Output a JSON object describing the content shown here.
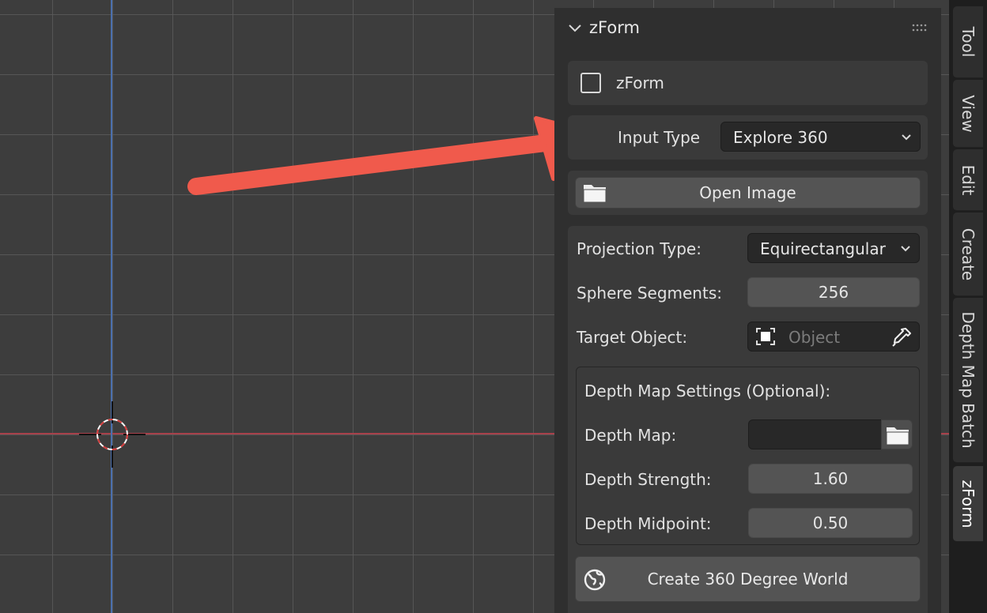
{
  "panel": {
    "title": "zForm",
    "enable_label": "zForm",
    "input_type_label": "Input Type",
    "input_type_value": "Explore 360",
    "open_image_label": "Open Image",
    "projection_label": "Projection Type:",
    "projection_value": "Equirectangular",
    "segments_label": "Sphere Segments:",
    "segments_value": "256",
    "target_label": "Target Object:",
    "target_placeholder": "Object",
    "depth_section_title": "Depth Map Settings (Optional):",
    "depth_map_label": "Depth Map:",
    "depth_map_value": "",
    "depth_strength_label": "Depth Strength:",
    "depth_strength_value": "1.60",
    "depth_midpoint_label": "Depth Midpoint:",
    "depth_midpoint_value": "0.50",
    "create_world_label": "Create 360 Degree World"
  },
  "sidebar_tabs": [
    "Tool",
    "View",
    "Edit",
    "Create",
    "Depth Map Batch",
    "zForm"
  ],
  "active_tab": "zForm",
  "colors": {
    "x_axis": "#a8414b",
    "y_axis": "#4a6fae",
    "annotation_arrow": "#f05a4c"
  },
  "icons": [
    "chevron-down-icon",
    "drag-grip-icon",
    "checkbox-icon",
    "folder-icon",
    "object-icon",
    "eyedropper-icon",
    "world-icon",
    "3d-cursor-icon"
  ]
}
